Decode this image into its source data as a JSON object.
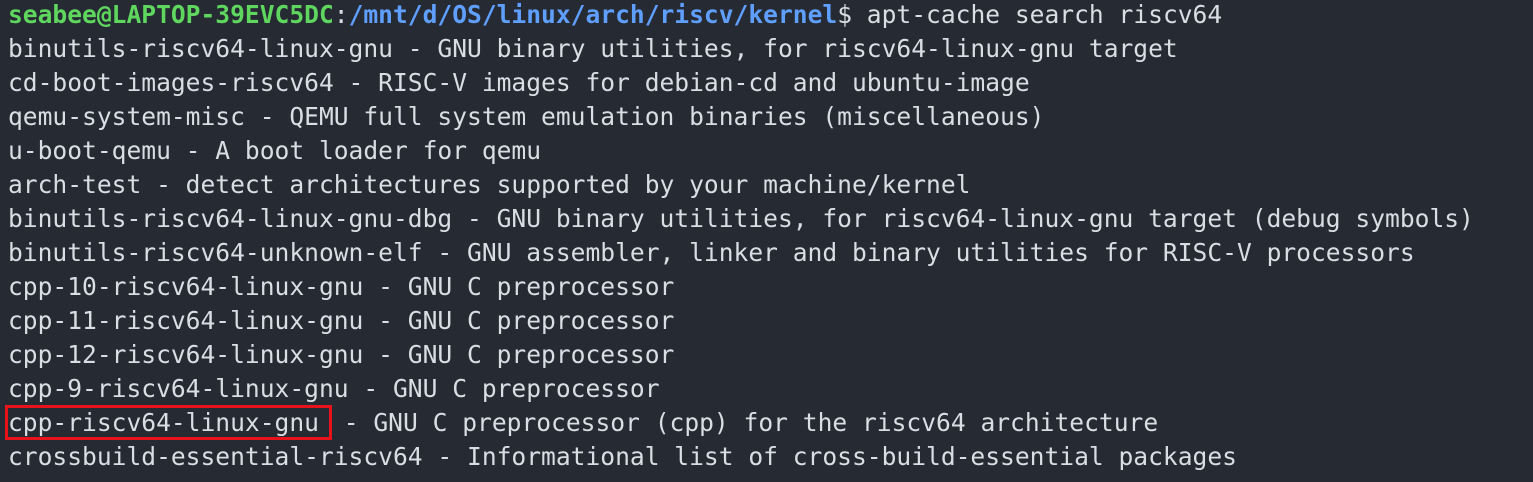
{
  "prompt": {
    "user_host": "seabee@LAPTOP-39EVC5DC",
    "separator": ":",
    "path": "/mnt/d/OS/linux/arch/riscv/kernel",
    "symbol": "$",
    "command": " apt-cache search riscv64"
  },
  "colors": {
    "background": "#262a33",
    "text": "#dadde4",
    "prompt_user": "#5fd75f",
    "prompt_path": "#5f9fff",
    "highlight_box": "#e8121a"
  },
  "output": [
    "binutils-riscv64-linux-gnu - GNU binary utilities, for riscv64-linux-gnu target",
    "cd-boot-images-riscv64 - RISC-V images for debian-cd and ubuntu-image",
    "qemu-system-misc - QEMU full system emulation binaries (miscellaneous)",
    "u-boot-qemu - A boot loader for qemu",
    "arch-test - detect architectures supported by your machine/kernel",
    "binutils-riscv64-linux-gnu-dbg - GNU binary utilities, for riscv64-linux-gnu target (debug symbols)",
    "binutils-riscv64-unknown-elf - GNU assembler, linker and binary utilities for RISC-V processors",
    "cpp-10-riscv64-linux-gnu - GNU C preprocessor",
    "cpp-11-riscv64-linux-gnu - GNU C preprocessor",
    "cpp-12-riscv64-linux-gnu - GNU C preprocessor",
    "cpp-9-riscv64-linux-gnu - GNU C preprocessor"
  ],
  "highlighted": {
    "package": "cpp-riscv64-linux-gnu",
    "rest": " - GNU C preprocessor (cpp) for the riscv64 architecture"
  },
  "last_line": "crossbuild-essential-riscv64 - Informational list of cross-build-essential packages"
}
